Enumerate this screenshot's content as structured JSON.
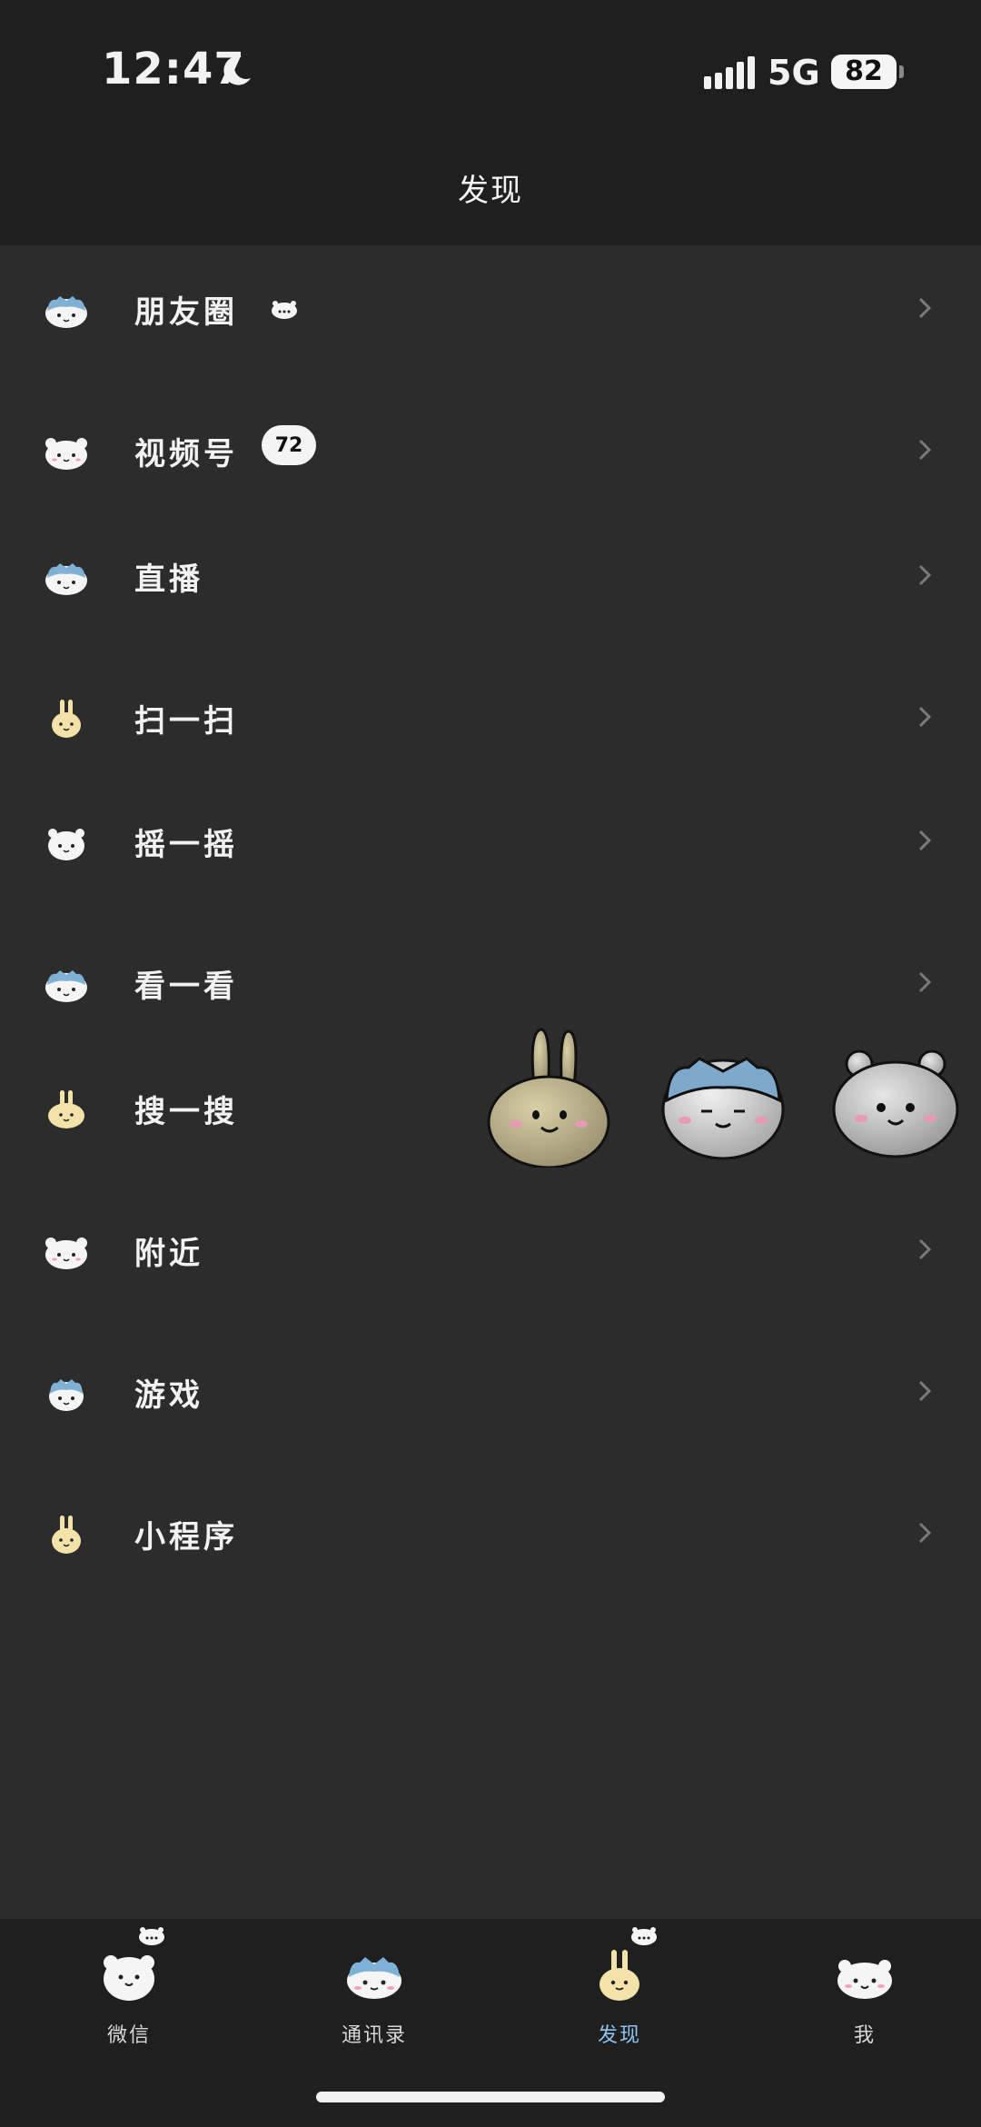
{
  "status_bar": {
    "time": "12:47",
    "network": "5G",
    "battery": "82"
  },
  "header": {
    "title": "发现"
  },
  "menu": {
    "items": [
      {
        "label": "朋友圈",
        "icon": "hachiware-icon"
      },
      {
        "label": "视频号",
        "icon": "chiikawa-icon",
        "badge": "72"
      },
      {
        "label": "直播",
        "icon": "hachiware-icon"
      },
      {
        "label": "扫一扫",
        "icon": "usagi-icon"
      },
      {
        "label": "摇一摇",
        "icon": "chiikawa-icon"
      },
      {
        "label": "看一看",
        "icon": "hachiware-icon"
      },
      {
        "label": "搜一搜",
        "icon": "usagi-icon"
      },
      {
        "label": "附近",
        "icon": "chiikawa-icon"
      },
      {
        "label": "游戏",
        "icon": "hachiware-icon"
      },
      {
        "label": "小程序",
        "icon": "usagi-icon"
      }
    ]
  },
  "stickers": [
    "usagi-sticker",
    "hachiware-sticker",
    "chiikawa-sticker"
  ],
  "tabbar": {
    "tabs": [
      {
        "label": "微信",
        "icon": "chiikawa-icon"
      },
      {
        "label": "通讯录",
        "icon": "hachiware-icon"
      },
      {
        "label": "发现",
        "icon": "usagi-icon",
        "active": true
      },
      {
        "label": "我",
        "icon": "chiikawa-icon"
      }
    ]
  },
  "colors": {
    "background": "#2c2c2c",
    "bar": "#1f1f1f",
    "active_tab": "#8fc3ee"
  }
}
